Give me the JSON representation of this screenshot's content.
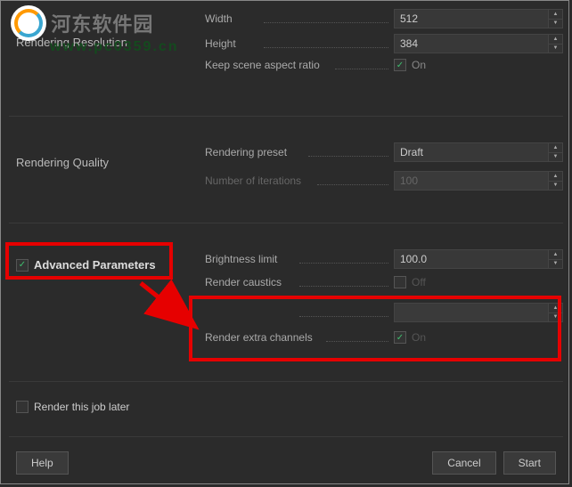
{
  "watermark": {
    "title": "河东软件园",
    "url": "www.pc0359.cn"
  },
  "sections": {
    "resolution": {
      "title": "Rendering Resolution",
      "width_label": "Width",
      "width_value": "512",
      "height_label": "Height",
      "height_value": "384",
      "aspect_label": "Keep scene aspect ratio",
      "aspect_value": "On"
    },
    "quality": {
      "title": "Rendering Quality",
      "preset_label": "Rendering preset",
      "preset_value": "Draft",
      "iterations_label": "Number of iterations",
      "iterations_value": "100"
    },
    "advanced": {
      "title": "Advanced Parameters",
      "brightness_label": "Brightness limit",
      "brightness_value": "100.0",
      "caustics_label": "Render caustics",
      "caustics_value": "Off",
      "extra_label": "Render extra channels",
      "extra_value": "On"
    },
    "later": {
      "label": "Render this job later"
    }
  },
  "footer": {
    "help": "Help",
    "cancel": "Cancel",
    "start": "Start"
  }
}
